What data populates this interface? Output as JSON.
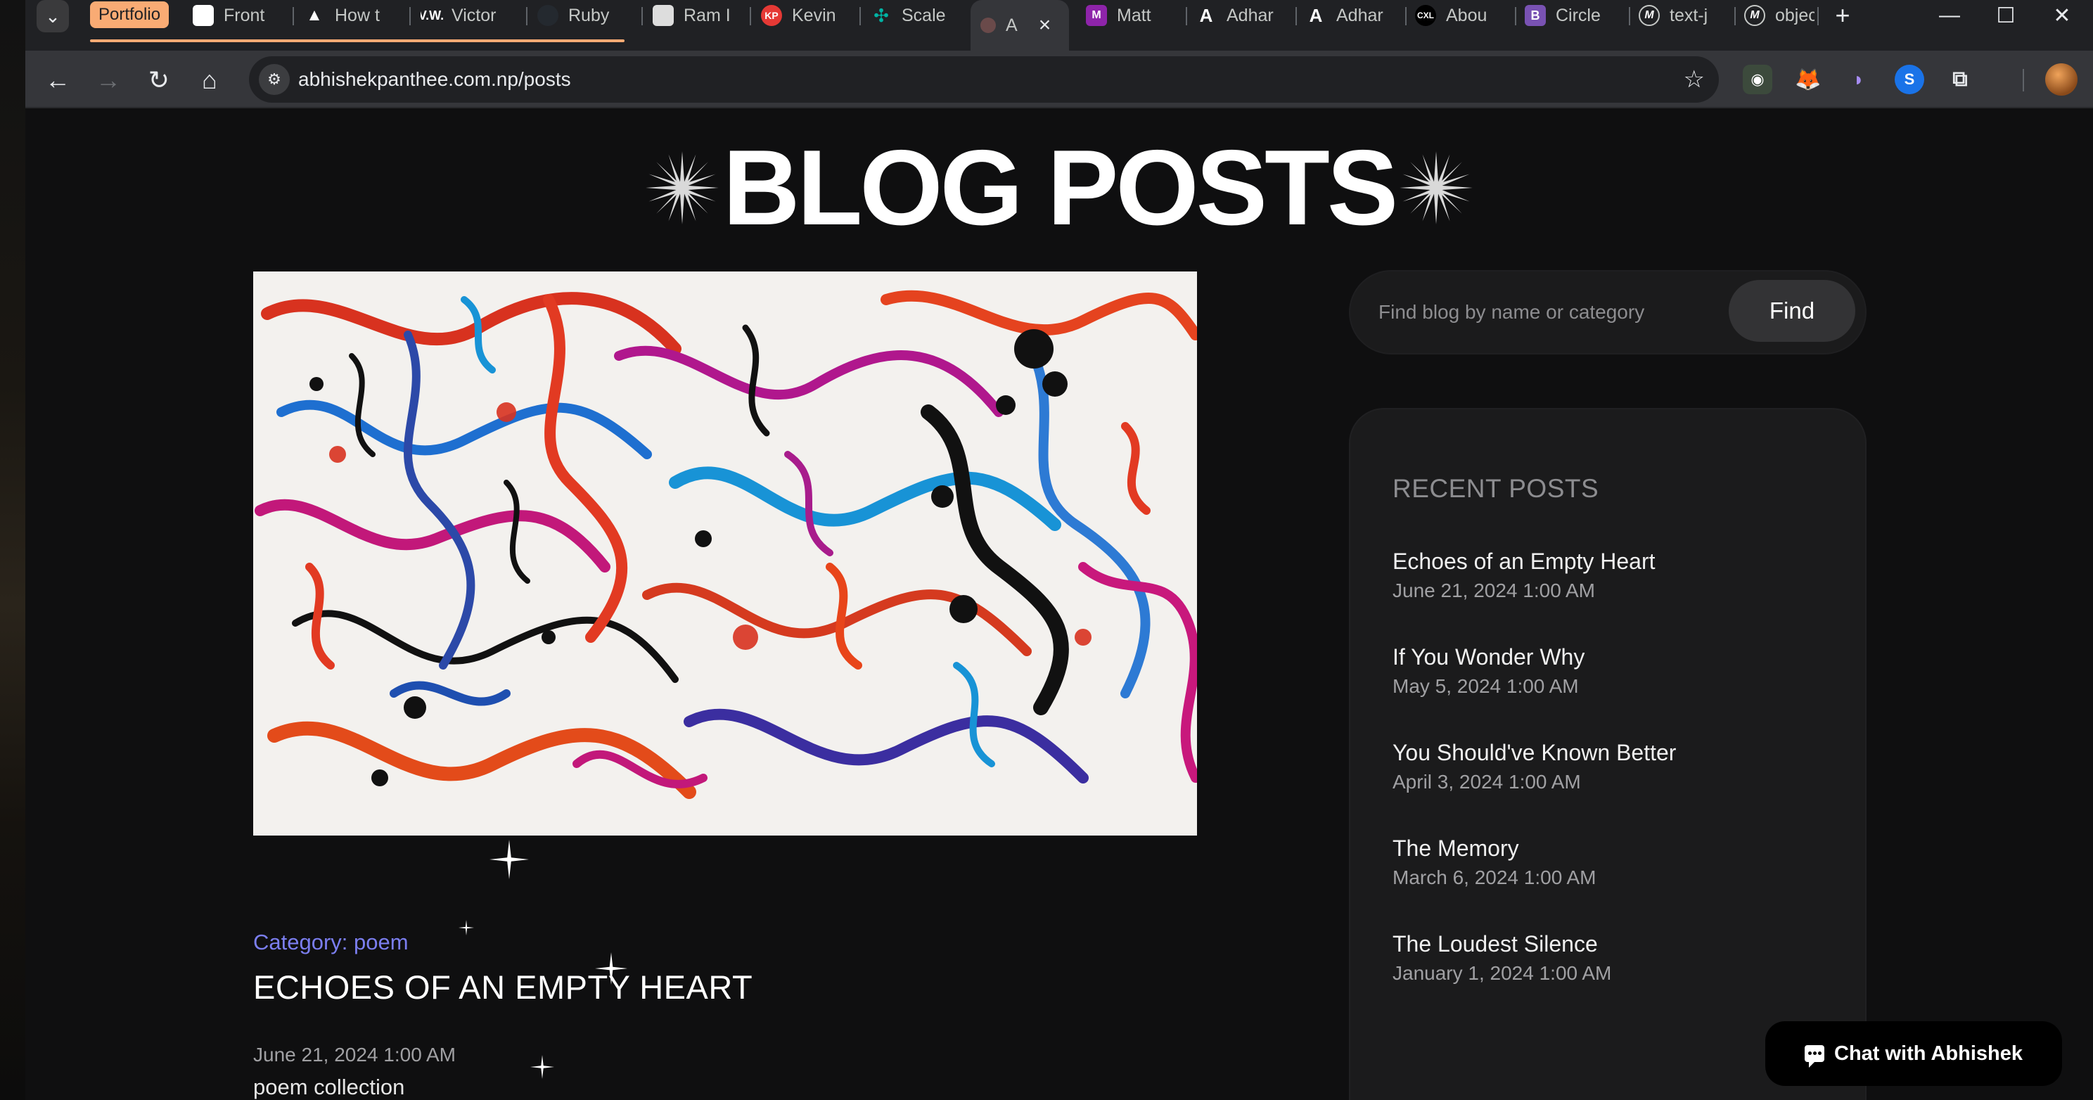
{
  "browser": {
    "tab_group_label": "Portfolio",
    "tabs": [
      {
        "label": "Front",
        "icon": "frontend-icon",
        "color": "#ffffff"
      },
      {
        "label": "How t",
        "icon": "triangle-logo-icon",
        "color": "#ffffff"
      },
      {
        "label": "Victor",
        "icon": "vw-logo-icon",
        "color": "#ffffff"
      },
      {
        "label": "Ruby",
        "icon": "github-icon",
        "color": "#24292f"
      },
      {
        "label": "Ram I",
        "icon": "profile-photo-icon",
        "color": "#eeeeee"
      },
      {
        "label": "Kevin",
        "icon": "kp-logo-icon",
        "color": "#e53935"
      },
      {
        "label": "Scale",
        "icon": "scale-logo-icon",
        "color": "#00b3a4"
      },
      {
        "label": "A",
        "icon": "avatar-favicon-icon",
        "color": "#c48a6a"
      },
      {
        "label": "Matt",
        "icon": "matt-logo-icon",
        "color": "#8e24aa"
      },
      {
        "label": "Adhar",
        "icon": "a-logo-icon",
        "color": "#ffffff"
      },
      {
        "label": "Adhar",
        "icon": "a-logo-icon",
        "color": "#ffffff"
      },
      {
        "label": "Abou",
        "icon": "cxl-logo-icon",
        "color": "#000000"
      },
      {
        "label": "Circle",
        "icon": "bootstrap-icon",
        "color": "#7952b3"
      },
      {
        "label": "text-j",
        "icon": "m-logo-icon",
        "color": "#ffffff"
      },
      {
        "label": "objec",
        "icon": "m-logo-icon",
        "color": "#ffffff"
      }
    ],
    "url": "abhishekpanthee.com.np/posts"
  },
  "page": {
    "title": "BLOG POSTS",
    "featured_post": {
      "category": "Category: poem",
      "title": "ECHOES OF AN EMPTY HEART",
      "date": "June 21, 2024 1:00 AM",
      "excerpt": "poem collection"
    },
    "search": {
      "placeholder": "Find blog by name or category",
      "button_label": "Find"
    },
    "recent_posts": {
      "heading": "RECENT POSTS",
      "items": [
        {
          "title": "Echoes of an Empty Heart",
          "date": "June 21, 2024 1:00 AM"
        },
        {
          "title": "If You Wonder Why",
          "date": "May 5, 2024 1:00 AM"
        },
        {
          "title": "You Should've Known Better",
          "date": "April 3, 2024 1:00 AM"
        },
        {
          "title": "The Memory",
          "date": "March 6, 2024 1:00 AM"
        },
        {
          "title": "The Loudest Silence",
          "date": "January 1, 2024 1:00 AM"
        }
      ]
    },
    "chat_button_label": "Chat with Abhishek"
  },
  "colors": {
    "page_background": "#0f0f10",
    "accent_category": "#7b7ef0",
    "tab_group": "#f9ab74",
    "card_background": "#1b1b1c"
  }
}
